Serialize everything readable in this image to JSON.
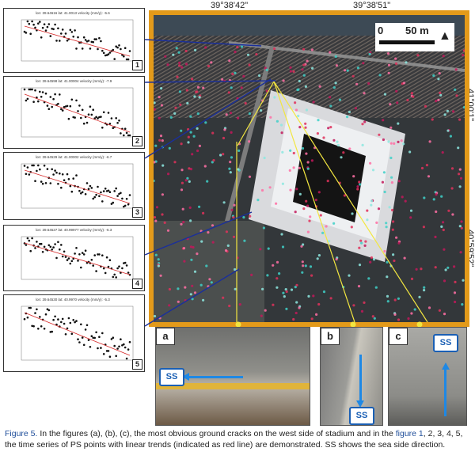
{
  "coords": {
    "top_left": "39°38'42\"",
    "top_right": "39°38'51\"",
    "right_top": "41°00'1\"",
    "right_bottom": "40°59'52\""
  },
  "scale": {
    "zero": "0",
    "distance": "50 m"
  },
  "panels": [
    {
      "number": "1",
      "header": "lon: 39.64616 lat: 41.0013 velocity (mm/y): -5.6"
    },
    {
      "number": "2",
      "header": "lon: 39.64598 lat: 41.00004 velocity (mm/y): -7.9"
    },
    {
      "number": "3",
      "header": "lon: 39.64529 lat: 41.00002 velocity (mm/y): -6.7"
    },
    {
      "number": "4",
      "header": "lon: 39.64527 lat: 40.99977 velocity (mm/y): -6.3"
    },
    {
      "number": "5",
      "header": "lon: 39.64530 lat: 40.9970 velocity (mm/y): -5.3"
    }
  ],
  "photos": [
    {
      "label": "a",
      "ss": "SS"
    },
    {
      "label": "b",
      "ss": "SS"
    },
    {
      "label": "c",
      "ss": "SS"
    }
  ],
  "caption": {
    "label": "Figure 5.",
    "t1": " In the figures (a), (b), (c), the most obvious ground cracks on the west side of stadium and in the ",
    "link": "figure 1",
    "t2": ", 2, 3, 4, 5, the time series of PS points with linear trends (indicated as red line) are demonstrated. SS shows the sea side direction."
  },
  "colors": {
    "frame": "#e39a1a",
    "connector": "#1a2f9c",
    "crack": "#f2e640",
    "ss": "#1a5fb4",
    "trend": "#d62828"
  }
}
